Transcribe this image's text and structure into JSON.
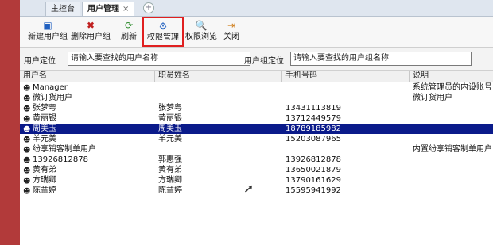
{
  "tabs": [
    {
      "label": "主控台"
    },
    {
      "label": "用户管理",
      "close": "×"
    }
  ],
  "toolbar": {
    "new_group": "新建用户组",
    "delete_group": "删除用户组",
    "refresh": "刷新",
    "perm_manage": "权限管理",
    "perm_browse": "权限浏览",
    "close": "关闭"
  },
  "search": {
    "user_label": "用户定位",
    "user_value": "请输入要查找的用户名称",
    "group_label": "用户组定位",
    "group_value": "请输入要查找的用户组名称"
  },
  "columns": [
    "用户名",
    "职员姓名",
    "手机号码",
    "说明"
  ],
  "rows": [
    {
      "name": "Manager",
      "staff": "",
      "phone": "",
      "desc": "系统管理员的内设账号"
    },
    {
      "name": "微订货用户",
      "staff": "",
      "phone": "",
      "desc": "微订货用户"
    },
    {
      "name": "张梦粤",
      "staff": "张梦粤",
      "phone": "13431113819",
      "desc": ""
    },
    {
      "name": "黄丽银",
      "staff": "黄丽银",
      "phone": "13712449579",
      "desc": ""
    },
    {
      "name": "周美玉",
      "staff": "周美玉",
      "phone": "18789185982",
      "desc": ""
    },
    {
      "name": "羊元美",
      "staff": "羊元美",
      "phone": "15203087965",
      "desc": ""
    },
    {
      "name": "纷享销客制单用户",
      "staff": "",
      "phone": "",
      "desc": "内置纷享销客制单用户"
    },
    {
      "name": "13926812878",
      "staff": "郭惠强",
      "phone": "13926812878",
      "desc": ""
    },
    {
      "name": "黄有弟",
      "staff": "黄有弟",
      "phone": "13650021879",
      "desc": ""
    },
    {
      "name": "方瑞卿",
      "staff": "方瑞卿",
      "phone": "13790161629",
      "desc": ""
    },
    {
      "name": "陈益婷",
      "staff": "陈益婷",
      "phone": "15595941992",
      "desc": ""
    }
  ],
  "selected_row": 4,
  "icons": {
    "new": "new-group-icon",
    "delete": "delete-group-icon",
    "refresh": "refresh-icon",
    "perm": "permission-manage-icon",
    "browse": "permission-browse-icon",
    "close": "close-icon",
    "user": "user-icon",
    "add_tab": "add-tab-icon"
  },
  "colors": {
    "selection": "#0a1a8a",
    "highlight_box": "#e02020",
    "left_strip": "#b23a3a"
  }
}
